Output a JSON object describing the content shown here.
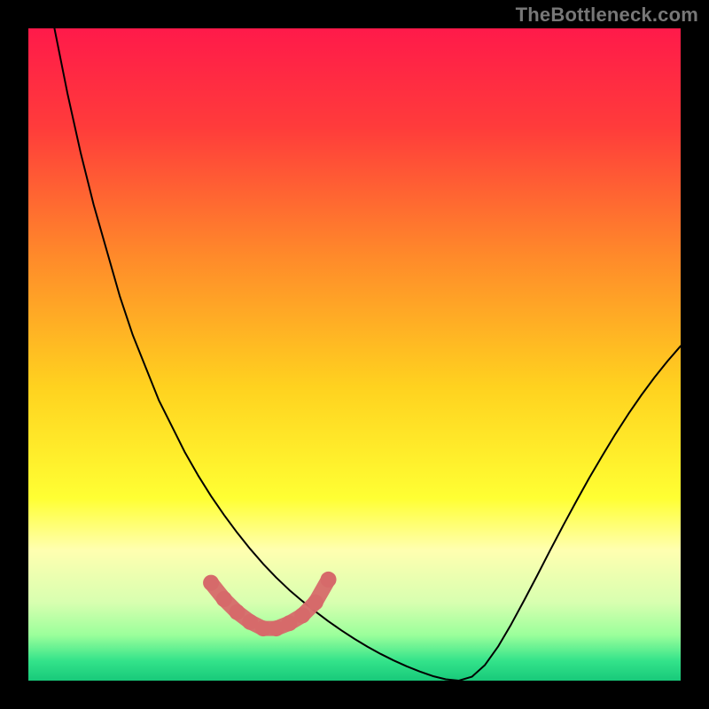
{
  "watermark": "TheBottleneck.com",
  "chart_data": {
    "type": "line",
    "title": "",
    "xlabel": "",
    "ylabel": "",
    "xlim": [
      0,
      100
    ],
    "ylim": [
      0,
      100
    ],
    "grid": false,
    "legend": false,
    "background_gradient": {
      "stops": [
        {
          "offset": 0.0,
          "color": "#ff1a4a"
        },
        {
          "offset": 0.15,
          "color": "#ff3b3b"
        },
        {
          "offset": 0.35,
          "color": "#ff8a2a"
        },
        {
          "offset": 0.55,
          "color": "#ffd21f"
        },
        {
          "offset": 0.72,
          "color": "#ffff33"
        },
        {
          "offset": 0.8,
          "color": "#ffffb0"
        },
        {
          "offset": 0.88,
          "color": "#d8ffb0"
        },
        {
          "offset": 0.93,
          "color": "#9bff9b"
        },
        {
          "offset": 0.97,
          "color": "#33e38a"
        },
        {
          "offset": 1.0,
          "color": "#18c97a"
        }
      ]
    },
    "series": [
      {
        "name": "curve",
        "stroke": "#000000",
        "stroke_width": 2,
        "x": [
          4,
          6,
          8,
          10,
          12,
          14,
          16,
          18,
          20,
          22,
          24,
          26,
          28,
          30,
          32,
          34,
          36,
          38,
          40,
          42,
          44,
          46,
          48,
          50,
          52,
          54,
          56,
          58,
          60,
          62,
          64,
          66,
          68,
          70,
          72,
          74,
          76,
          78,
          80,
          82,
          84,
          86,
          88,
          90,
          92,
          94,
          96,
          98,
          100
        ],
        "y": [
          100,
          90,
          81,
          73,
          66,
          59,
          53,
          48,
          43,
          39,
          35,
          31.5,
          28.3,
          25.4,
          22.7,
          20.2,
          17.9,
          15.8,
          13.9,
          12.2,
          10.6,
          9.1,
          7.7,
          6.4,
          5.2,
          4.1,
          3.1,
          2.2,
          1.4,
          0.7,
          0.2,
          0,
          0.6,
          2.4,
          5.2,
          8.6,
          12.3,
          16.1,
          20,
          23.8,
          27.5,
          31.1,
          34.5,
          37.8,
          40.9,
          43.8,
          46.5,
          49,
          51.3
        ]
      }
    ],
    "markers": {
      "name": "bottom-dots",
      "color": "#d66a6a",
      "radius": 9,
      "x": [
        28,
        30,
        32,
        34,
        36,
        38,
        40,
        42,
        44,
        46
      ],
      "y": [
        85,
        87.5,
        89.5,
        91,
        92,
        92,
        91.2,
        90,
        88,
        84.5
      ]
    }
  }
}
